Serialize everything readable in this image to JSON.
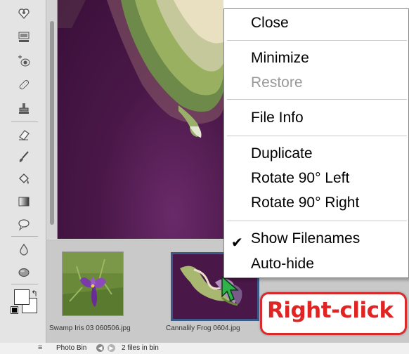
{
  "tools": [
    {
      "name": "red-eye-icon"
    },
    {
      "name": "cookie-cutter-icon"
    },
    {
      "name": "spot-healing-icon"
    },
    {
      "name": "healing-brush-icon"
    },
    {
      "name": "clone-stamp-icon"
    },
    {
      "name": "eraser-icon"
    },
    {
      "name": "brush-icon"
    },
    {
      "name": "paint-bucket-icon"
    },
    {
      "name": "gradient-icon"
    },
    {
      "name": "shape-icon"
    },
    {
      "name": "blur-icon"
    },
    {
      "name": "sponge-icon"
    }
  ],
  "context_menu": {
    "items": [
      {
        "label": "Close",
        "enabled": true
      },
      {
        "label": "Minimize",
        "enabled": true
      },
      {
        "label": "Restore",
        "enabled": false
      },
      {
        "label": "File Info",
        "enabled": true
      },
      {
        "label": "Duplicate",
        "enabled": true
      },
      {
        "label": "Rotate 90° Left",
        "enabled": true
      },
      {
        "label": "Rotate 90° Right",
        "enabled": true
      },
      {
        "label": "Show Filenames",
        "enabled": true,
        "checked": true
      },
      {
        "label": "Auto-hide",
        "enabled": true
      }
    ]
  },
  "photo_bin": {
    "files": [
      {
        "caption": "Swamp Iris 03 060506.jpg",
        "selected": false
      },
      {
        "caption": "Cannalily Frog 0604.jpg",
        "selected": true
      }
    ]
  },
  "status_bar": {
    "title": "Photo Bin",
    "count": "2 files in bin"
  },
  "callout": {
    "text": "Right-click",
    "border_color": "#d92b2b",
    "text_color": "#e02424"
  },
  "colors": {
    "canvas_background": "#4a1848",
    "bin_background": "#c9c9c9",
    "selection_border": "#3a5a8a"
  }
}
